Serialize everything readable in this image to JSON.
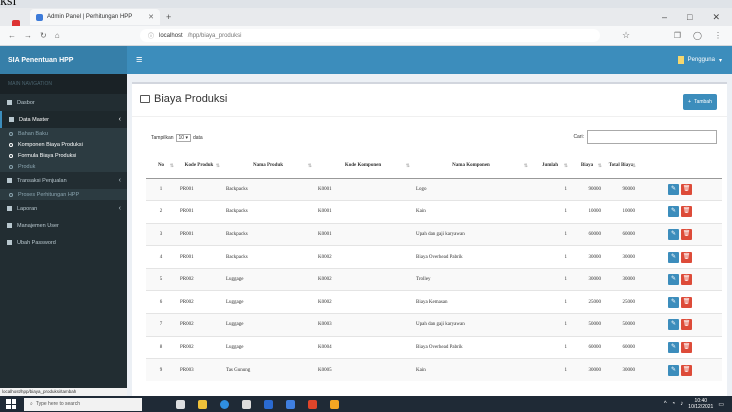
{
  "page_caption": "ksi",
  "browser": {
    "tab_title": "Admin Panel | Perhitungan HPP",
    "url_host": "localhost",
    "url_path": "/hpp/biaya_produksi"
  },
  "app": {
    "brand": "SIA Penentuan HPP",
    "user_label": "Pengguna"
  },
  "sidebar": {
    "header": "MAIN NAVIGATION",
    "items": [
      {
        "label": "Dasbor"
      },
      {
        "label": "Data Master"
      },
      {
        "label": "Transaksi Penjualan"
      },
      {
        "label": "Laporan"
      },
      {
        "label": "Manajemen User"
      },
      {
        "label": "Ubah Password"
      }
    ],
    "master_sub": [
      {
        "label": "Bahan Baku"
      },
      {
        "label": "Komponen Biaya Produksi"
      },
      {
        "label": "Formula Biaya Produksi"
      },
      {
        "label": "Produk"
      }
    ],
    "transaksi_sub": [
      {
        "label": "Proses Perhitungan HPP"
      }
    ],
    "status_url": "localhost/hpp/biaya_produksi/tambah"
  },
  "main": {
    "title": "Biaya Produksi",
    "add_button": "Tambah",
    "length_prefix": "Tampilkan",
    "length_value": "10",
    "length_suffix": "data",
    "search_label": "Cari:",
    "columns": [
      "No",
      "Kode Produk",
      "Nama Produk",
      "Kode Komponen",
      "Nama Komponen",
      "Jumlah",
      "Biaya",
      "Total Biaya",
      ""
    ],
    "rows": [
      {
        "no": "1",
        "kode_produk": "PR001",
        "nama_produk": "Backpacks",
        "kode_komponen": "K0001",
        "nama_komponen": "Logo",
        "jumlah": "1",
        "biaya": "90000",
        "total": "90000"
      },
      {
        "no": "2",
        "kode_produk": "PR001",
        "nama_produk": "Backpacks",
        "kode_komponen": "K0001",
        "nama_komponen": "Kain",
        "jumlah": "1",
        "biaya": "10000",
        "total": "10000"
      },
      {
        "no": "3",
        "kode_produk": "PR001",
        "nama_produk": "Backpacks",
        "kode_komponen": "K0001",
        "nama_komponen": "Upah dan gaji karyawan",
        "jumlah": "1",
        "biaya": "60000",
        "total": "60000"
      },
      {
        "no": "4",
        "kode_produk": "PR001",
        "nama_produk": "Backpacks",
        "kode_komponen": "K0002",
        "nama_komponen": "Biaya Overhead Pabrik",
        "jumlah": "1",
        "biaya": "30000",
        "total": "30000"
      },
      {
        "no": "5",
        "kode_produk": "PR002",
        "nama_produk": "Luggage",
        "kode_komponen": "K0002",
        "nama_komponen": "Trolley",
        "jumlah": "1",
        "biaya": "30000",
        "total": "30000"
      },
      {
        "no": "6",
        "kode_produk": "PR002",
        "nama_produk": "Luggage",
        "kode_komponen": "K0002",
        "nama_komponen": "Biaya Kemasan",
        "jumlah": "1",
        "biaya": "25000",
        "total": "25000"
      },
      {
        "no": "7",
        "kode_produk": "PR002",
        "nama_produk": "Luggage",
        "kode_komponen": "K0003",
        "nama_komponen": "Upah dan gaji karyawan",
        "jumlah": "1",
        "biaya": "50000",
        "total": "50000"
      },
      {
        "no": "8",
        "kode_produk": "PR002",
        "nama_produk": "Luggage",
        "kode_komponen": "K0004",
        "nama_komponen": "Biaya Overhead Pabrik",
        "jumlah": "1",
        "biaya": "60000",
        "total": "60000"
      },
      {
        "no": "9",
        "kode_produk": "PR003",
        "nama_produk": "Tas Gunung",
        "kode_komponen": "K0005",
        "nama_komponen": "Kain",
        "jumlah": "1",
        "biaya": "30000",
        "total": "30000"
      }
    ]
  },
  "taskbar": {
    "search_placeholder": "Type here to search",
    "time": "10:40",
    "date": "10/12/2021"
  },
  "colors": {
    "header_blue": "#3c8dbc",
    "sidebar_dark": "#222d32",
    "edit_blue": "#3c8dbc",
    "delete_red": "#dd4b39"
  }
}
